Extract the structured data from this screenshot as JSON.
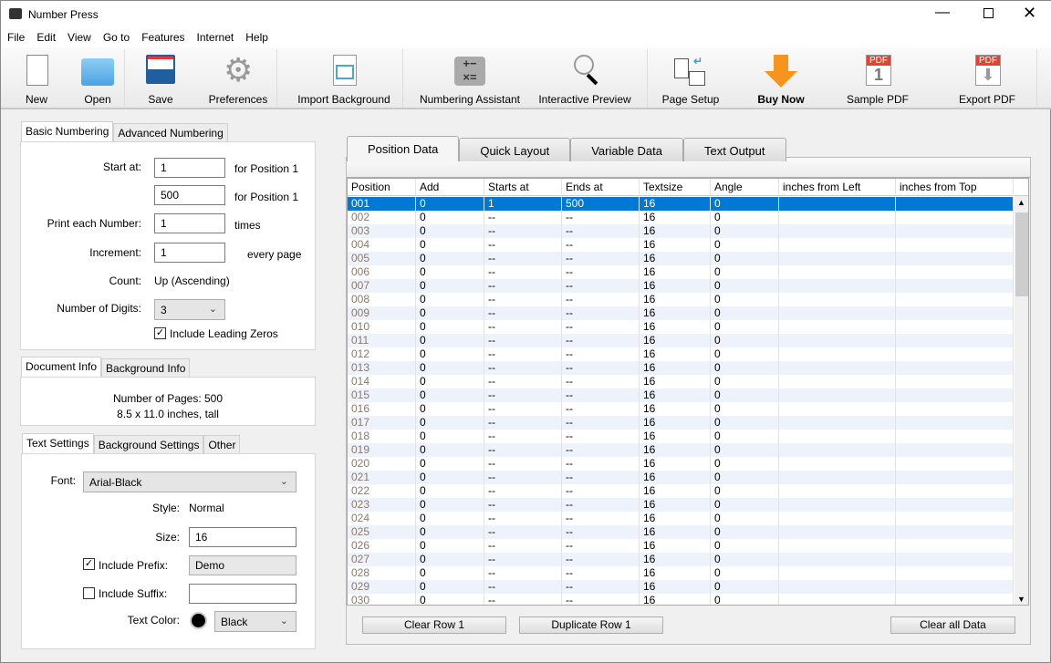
{
  "window": {
    "title": "Number Press",
    "controls": [
      "minimize",
      "maximize",
      "close"
    ]
  },
  "menu": [
    "File",
    "Edit",
    "View",
    "Go to",
    "Features",
    "Internet",
    "Help"
  ],
  "toolbar": [
    {
      "label": "New",
      "icon": "new-document-icon"
    },
    {
      "label": "Open",
      "icon": "folder-icon"
    },
    {
      "label": "Save",
      "icon": "floppy-disk-icon"
    },
    {
      "label": "Preferences",
      "icon": "gear-icon"
    },
    {
      "label": "Import Background",
      "icon": "import-background-icon"
    },
    {
      "label": "Numbering Assistant",
      "icon": "calculator-icon"
    },
    {
      "label": "Interactive Preview",
      "icon": "magnifier-icon"
    },
    {
      "label": "Page Setup",
      "icon": "page-setup-icon"
    },
    {
      "label": "Buy Now",
      "icon": "orange-down-arrow-icon"
    },
    {
      "label": "Sample PDF",
      "icon": "pdf-icon"
    },
    {
      "label": "Export PDF",
      "icon": "pdf-export-icon"
    }
  ],
  "numbering": {
    "tabs": [
      "Basic Numbering",
      "Advanced Numbering"
    ],
    "start_label": "Start at:",
    "start_value": "1",
    "start_suffix": "for Position 1",
    "end_value": "500",
    "end_suffix": "for Position 1",
    "print_label": "Print each Number:",
    "print_value": "1",
    "print_suffix": "times",
    "increment_label": "Increment:",
    "increment_value": "1",
    "increment_suffix": "every page",
    "count_label": "Count:",
    "count_value": "Up (Ascending)",
    "digits_label": "Number of Digits:",
    "digits_value": "3",
    "leading_zeros_label": "Include Leading Zeros",
    "leading_zeros_checked": true
  },
  "docinfo": {
    "tabs": [
      "Document Info",
      "Background Info"
    ],
    "pages": "Number of Pages: 500",
    "size": "8.5 x 11.0 inches, tall"
  },
  "text_settings": {
    "tabs": [
      "Text Settings",
      "Background Settings",
      "Other"
    ],
    "font_label": "Font:",
    "font_value": "Arial-Black",
    "style_label": "Style:",
    "style_value": "Normal",
    "size_label": "Size:",
    "size_value": "16",
    "prefix_label": "Include Prefix:",
    "prefix_checked": true,
    "prefix_value": "Demo",
    "suffix_label": "Include Suffix:",
    "suffix_checked": false,
    "suffix_value": "",
    "color_label": "Text Color:",
    "color_value": "Black",
    "color_swatch": "#000000"
  },
  "main": {
    "tabs": [
      "Position Data",
      "Quick Layout",
      "Variable Data",
      "Text Output"
    ],
    "columns": [
      "Position",
      "Add",
      "Starts at",
      "Ends at",
      "Textsize",
      "Angle",
      "inches from Left",
      "inches from Top"
    ],
    "rows": [
      [
        "001",
        "0",
        "1",
        "500",
        "16",
        "0",
        "",
        ""
      ],
      [
        "002",
        "0",
        "--",
        "--",
        "16",
        "0",
        "",
        ""
      ],
      [
        "003",
        "0",
        "--",
        "--",
        "16",
        "0",
        "",
        ""
      ],
      [
        "004",
        "0",
        "--",
        "--",
        "16",
        "0",
        "",
        ""
      ],
      [
        "005",
        "0",
        "--",
        "--",
        "16",
        "0",
        "",
        ""
      ],
      [
        "006",
        "0",
        "--",
        "--",
        "16",
        "0",
        "",
        ""
      ],
      [
        "007",
        "0",
        "--",
        "--",
        "16",
        "0",
        "",
        ""
      ],
      [
        "008",
        "0",
        "--",
        "--",
        "16",
        "0",
        "",
        ""
      ],
      [
        "009",
        "0",
        "--",
        "--",
        "16",
        "0",
        "",
        ""
      ],
      [
        "010",
        "0",
        "--",
        "--",
        "16",
        "0",
        "",
        ""
      ],
      [
        "011",
        "0",
        "--",
        "--",
        "16",
        "0",
        "",
        ""
      ],
      [
        "012",
        "0",
        "--",
        "--",
        "16",
        "0",
        "",
        ""
      ],
      [
        "013",
        "0",
        "--",
        "--",
        "16",
        "0",
        "",
        ""
      ],
      [
        "014",
        "0",
        "--",
        "--",
        "16",
        "0",
        "",
        ""
      ],
      [
        "015",
        "0",
        "--",
        "--",
        "16",
        "0",
        "",
        ""
      ],
      [
        "016",
        "0",
        "--",
        "--",
        "16",
        "0",
        "",
        ""
      ],
      [
        "017",
        "0",
        "--",
        "--",
        "16",
        "0",
        "",
        ""
      ],
      [
        "018",
        "0",
        "--",
        "--",
        "16",
        "0",
        "",
        ""
      ],
      [
        "019",
        "0",
        "--",
        "--",
        "16",
        "0",
        "",
        ""
      ],
      [
        "020",
        "0",
        "--",
        "--",
        "16",
        "0",
        "",
        ""
      ],
      [
        "021",
        "0",
        "--",
        "--",
        "16",
        "0",
        "",
        ""
      ],
      [
        "022",
        "0",
        "--",
        "--",
        "16",
        "0",
        "",
        ""
      ],
      [
        "023",
        "0",
        "--",
        "--",
        "16",
        "0",
        "",
        ""
      ],
      [
        "024",
        "0",
        "--",
        "--",
        "16",
        "0",
        "",
        ""
      ],
      [
        "025",
        "0",
        "--",
        "--",
        "16",
        "0",
        "",
        ""
      ],
      [
        "026",
        "0",
        "--",
        "--",
        "16",
        "0",
        "",
        ""
      ],
      [
        "027",
        "0",
        "--",
        "--",
        "16",
        "0",
        "",
        ""
      ],
      [
        "028",
        "0",
        "--",
        "--",
        "16",
        "0",
        "",
        ""
      ],
      [
        "029",
        "0",
        "--",
        "--",
        "16",
        "0",
        "",
        ""
      ],
      [
        "030",
        "0",
        "--",
        "--",
        "16",
        "0",
        "",
        ""
      ]
    ],
    "selected_row": 0,
    "buttons": {
      "clear_row": "Clear Row 1",
      "duplicate_row": "Duplicate Row 1",
      "clear_all": "Clear all Data"
    }
  },
  "colors": {
    "selection": "#0078d7",
    "alt_row": "#eef3fb",
    "buy_now": "#f7941d",
    "pdf_red": "#e8402a"
  }
}
